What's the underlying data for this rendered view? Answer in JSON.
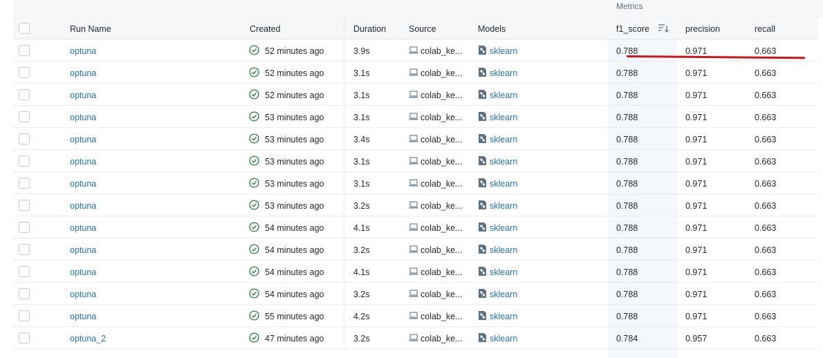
{
  "group_header": {
    "metrics_label": "Metrics"
  },
  "columns": {
    "run_name": "Run Name",
    "created": "Created",
    "duration": "Duration",
    "source": "Source",
    "models": "Models",
    "f1_score": "f1_score",
    "precision": "precision",
    "recall": "recall"
  },
  "rows": [
    {
      "run_name": "optuna",
      "created": "52 minutes ago",
      "duration": "3.9s",
      "source": "colab_ke...",
      "model": "sklearn",
      "f1_score": "0.788",
      "precision": "0.971",
      "recall": "0.663"
    },
    {
      "run_name": "optuna",
      "created": "52 minutes ago",
      "duration": "3.1s",
      "source": "colab_ke...",
      "model": "sklearn",
      "f1_score": "0.788",
      "precision": "0.971",
      "recall": "0.663"
    },
    {
      "run_name": "optuna",
      "created": "52 minutes ago",
      "duration": "3.1s",
      "source": "colab_ke...",
      "model": "sklearn",
      "f1_score": "0.788",
      "precision": "0.971",
      "recall": "0.663"
    },
    {
      "run_name": "optuna",
      "created": "53 minutes ago",
      "duration": "3.1s",
      "source": "colab_ke...",
      "model": "sklearn",
      "f1_score": "0.788",
      "precision": "0.971",
      "recall": "0.663"
    },
    {
      "run_name": "optuna",
      "created": "53 minutes ago",
      "duration": "3.4s",
      "source": "colab_ke...",
      "model": "sklearn",
      "f1_score": "0.788",
      "precision": "0.971",
      "recall": "0.663"
    },
    {
      "run_name": "optuna",
      "created": "53 minutes ago",
      "duration": "3.1s",
      "source": "colab_ke...",
      "model": "sklearn",
      "f1_score": "0.788",
      "precision": "0.971",
      "recall": "0.663"
    },
    {
      "run_name": "optuna",
      "created": "53 minutes ago",
      "duration": "3.1s",
      "source": "colab_ke...",
      "model": "sklearn",
      "f1_score": "0.788",
      "precision": "0.971",
      "recall": "0.663"
    },
    {
      "run_name": "optuna",
      "created": "53 minutes ago",
      "duration": "3.2s",
      "source": "colab_ke...",
      "model": "sklearn",
      "f1_score": "0.788",
      "precision": "0.971",
      "recall": "0.663"
    },
    {
      "run_name": "optuna",
      "created": "54 minutes ago",
      "duration": "4.1s",
      "source": "colab_ke...",
      "model": "sklearn",
      "f1_score": "0.788",
      "precision": "0.971",
      "recall": "0.663"
    },
    {
      "run_name": "optuna",
      "created": "54 minutes ago",
      "duration": "3.2s",
      "source": "colab_ke...",
      "model": "sklearn",
      "f1_score": "0.788",
      "precision": "0.971",
      "recall": "0.663"
    },
    {
      "run_name": "optuna",
      "created": "54 minutes ago",
      "duration": "4.1s",
      "source": "colab_ke...",
      "model": "sklearn",
      "f1_score": "0.788",
      "precision": "0.971",
      "recall": "0.663"
    },
    {
      "run_name": "optuna",
      "created": "54 minutes ago",
      "duration": "3.2s",
      "source": "colab_ke...",
      "model": "sklearn",
      "f1_score": "0.788",
      "precision": "0.971",
      "recall": "0.663"
    },
    {
      "run_name": "optuna",
      "created": "55 minutes ago",
      "duration": "4.2s",
      "source": "colab_ke...",
      "model": "sklearn",
      "f1_score": "0.788",
      "precision": "0.971",
      "recall": "0.663"
    },
    {
      "run_name": "optuna_2",
      "created": "47 minutes ago",
      "duration": "3.2s",
      "source": "colab_ke...",
      "model": "sklearn",
      "f1_score": "0.784",
      "precision": "0.957",
      "recall": "0.663"
    }
  ],
  "icons": {
    "status": "check-circle-icon",
    "source": "laptop-icon",
    "model": "model-icon",
    "sort": "sort-descending-icon"
  },
  "colors": {
    "link": "#2272b4",
    "status_ok": "#277c43",
    "annotation": "#d0141b",
    "header_bg": "#f5f7f9",
    "sorted_column_bg": "#f4f8fd"
  }
}
